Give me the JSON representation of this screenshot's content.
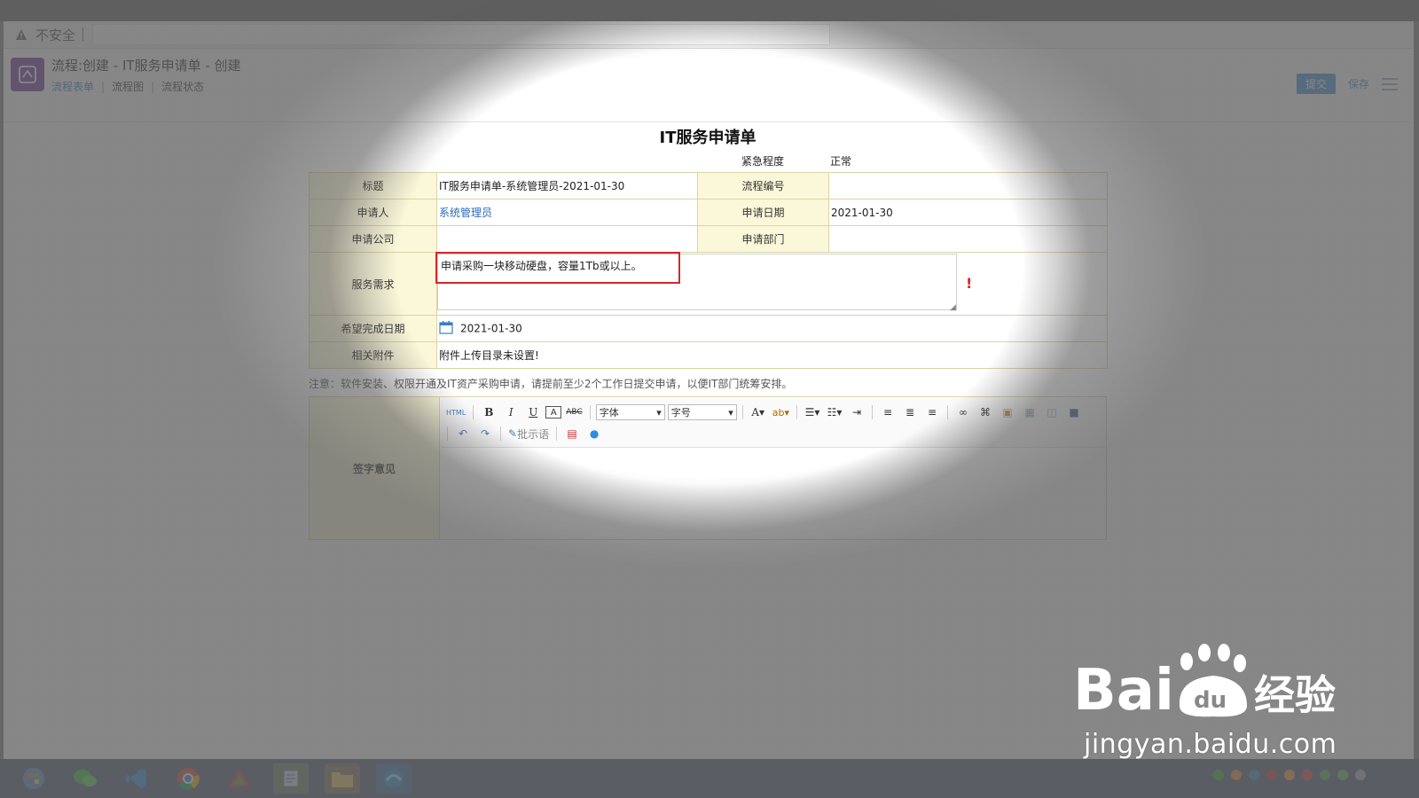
{
  "browser": {
    "security_label": "不安全"
  },
  "header": {
    "title": "流程:创建 - IT服务申请单 - 创建",
    "tabs": [
      {
        "label": "流程表单",
        "active": true
      },
      {
        "label": "流程图",
        "active": false
      },
      {
        "label": "流程状态",
        "active": false
      }
    ],
    "submit_label": "提交",
    "save_label": "保存"
  },
  "form": {
    "title": "IT服务申请单",
    "urgency_label": "紧急程度",
    "urgency_value": "正常",
    "fields": {
      "title_label": "标题",
      "title_value": "IT服务申请单-系统管理员-2021-01-30",
      "flow_no_label": "流程编号",
      "flow_no_value": "",
      "applicant_label": "申请人",
      "applicant_value": "系统管理员",
      "apply_date_label": "申请日期",
      "apply_date_value": "2021-01-30",
      "company_label": "申请公司",
      "company_value": "",
      "department_label": "申请部门",
      "department_value": "",
      "service_label": "服务需求",
      "service_value": "申请采购一块移动硬盘，容量1Tb或以上。",
      "required_mark": "!",
      "expected_date_label": "希望完成日期",
      "expected_date_value": "2021-01-30",
      "attachment_label": "相关附件",
      "attachment_value": "附件上传目录未设置!"
    },
    "note": "注意：软件安装、权限开通及IT资产采购申请，请提前至少2个工作日提交申请，以便IT部门统筹安排。",
    "sign_label": "签字意见"
  },
  "editor": {
    "html_label": "HTML",
    "font_placeholder": "字体",
    "size_placeholder": "字号",
    "comment_label": "批示语"
  },
  "watermark": {
    "url": "jingyan.baidu.com",
    "brand": "Bai",
    "brand_suffix": "经验"
  },
  "colors": {
    "accent": "#2a7fd4",
    "highlight": "#d9262b",
    "label_bg": "#fbf8d9",
    "logo": "#6a2f9c"
  }
}
